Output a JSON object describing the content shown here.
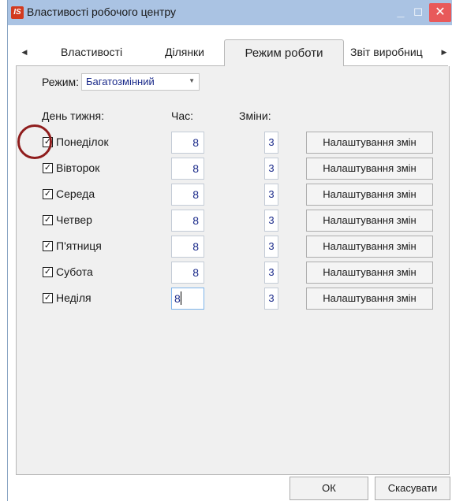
{
  "window": {
    "title": "Властивості робочого центру",
    "logo_text": "IS",
    "minimize_glyph": "_",
    "maximize_glyph": "☐",
    "close_glyph": "✕"
  },
  "tabs": [
    {
      "label": "Властивості",
      "active": false
    },
    {
      "label": "Ділянки",
      "active": false
    },
    {
      "label": "Режим роботи",
      "active": true
    },
    {
      "label": "Звіт виробниц",
      "active": false
    }
  ],
  "tab_nav": {
    "left_icon": "caret-left-icon",
    "right_icon": "caret-right-icon"
  },
  "mode": {
    "label": "Режим:",
    "value": "Багатозмінний"
  },
  "columns": {
    "day": "День тижня:",
    "hours": "Час:",
    "shifts": "Зміни:"
  },
  "days": [
    {
      "name": "Понеділок",
      "checked": true,
      "hours": "8",
      "shifts": "3",
      "button": "Налаштування змін"
    },
    {
      "name": "Вівторок",
      "checked": true,
      "hours": "8",
      "shifts": "3",
      "button": "Налаштування змін"
    },
    {
      "name": "Середа",
      "checked": true,
      "hours": "8",
      "shifts": "3",
      "button": "Налаштування змін"
    },
    {
      "name": "Четвер",
      "checked": true,
      "hours": "8",
      "shifts": "3",
      "button": "Налаштування змін"
    },
    {
      "name": "П'ятниця",
      "checked": true,
      "hours": "8",
      "shifts": "3",
      "button": "Налаштування змін"
    },
    {
      "name": "Субота",
      "checked": true,
      "hours": "8",
      "shifts": "3",
      "button": "Налаштування змін"
    },
    {
      "name": "Неділя",
      "checked": true,
      "hours": "8",
      "shifts": "3",
      "button": "Налаштування змін"
    }
  ],
  "footer": {
    "ok_label": "ОК",
    "cancel_label": "Скасувати"
  },
  "colors": {
    "titlebar": "#aac3e3",
    "close_button": "#e8595a",
    "value_text": "#1a2a8a",
    "annotation_circle": "#8f1d1d"
  }
}
